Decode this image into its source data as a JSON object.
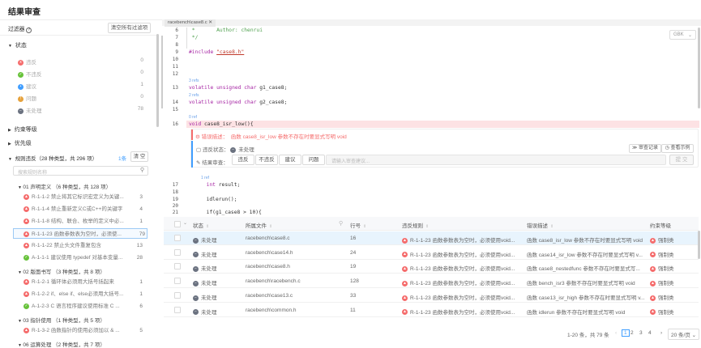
{
  "page_title": "结果审查",
  "filter": {
    "label": "过滤器",
    "clear_all": "清空所有过滤项",
    "status_section": "状态",
    "status_items": [
      {
        "label": "违反",
        "count": "0",
        "color": "red",
        "icon": "x"
      },
      {
        "label": "不违反",
        "count": "0",
        "color": "green",
        "icon": "✓"
      },
      {
        "label": "建议",
        "count": "1",
        "color": "blue",
        "icon": "•"
      },
      {
        "label": "问题",
        "count": "0",
        "color": "orange",
        "icon": "!"
      },
      {
        "label": "未处理",
        "count": "78",
        "color": "gray",
        "icon": "−"
      }
    ],
    "constraint_section": "约束等级",
    "priority_section": "优先级",
    "rules_section": "规则违反（28 种类型，共 296 项）",
    "rules_selected": "1条",
    "rules_clear": "清 空",
    "search_placeholder": "搜索规则名称",
    "groups": [
      {
        "label": "01 声明定义 （6 种类型，共 128 项）",
        "items": [
          {
            "label": "R-1-1-2 禁止将其它标识宏定义为关键...",
            "count": "3",
            "type": "red"
          },
          {
            "label": "R-1-1-4 禁止重新定义C或C++的关键字",
            "count": "4",
            "type": "red"
          },
          {
            "label": "R-1-1-8 结构、联合、枚举的定义中必...",
            "count": "1",
            "type": "red"
          },
          {
            "label": "R-1-1-23 函数参数表为空时，必须使...",
            "count": "79",
            "type": "red",
            "selected": true
          },
          {
            "label": "R-1-1-22 禁止头文件重复包含",
            "count": "13",
            "type": "red"
          },
          {
            "label": "A-1-1-1 建议使用 typedef 对基本变量...",
            "count": "28",
            "type": "green"
          }
        ]
      },
      {
        "label": "02 版面书写 （3 种类型，共 8 项）",
        "items": [
          {
            "label": "R-1-2-1 循环体必须用大括号括起来",
            "count": "1",
            "type": "red"
          },
          {
            "label": "R-1-2-2 if、else if、else必须用大括号...",
            "count": "1",
            "type": "red"
          },
          {
            "label": "A-1-2-3 C 语言程序建议使用标准 C ...",
            "count": "6",
            "type": "green"
          }
        ]
      },
      {
        "label": "03 指针使用 （1 种类型，共 5 项）",
        "items": [
          {
            "label": "R-1-3-2 函数指针的使用必须加以 & ...",
            "count": "5",
            "type": "red"
          }
        ]
      },
      {
        "label": "06 运算处理 （2 种类型，共 7 项）",
        "items": []
      }
    ]
  },
  "editor": {
    "tab": "racebench\\case8.c",
    "encoding": "GBK",
    "lines": [
      {
        "n": "6",
        "html": "<span class='cm'> *       Author: chenrui</span>"
      },
      {
        "n": "7",
        "html": "<span class='cm'> */</span>"
      },
      {
        "n": "8",
        "html": ""
      },
      {
        "n": "9",
        "html": "<span class='kw'>#include</span> <span class='str'>\"case8.h\"</span>"
      },
      {
        "n": "10",
        "html": ""
      },
      {
        "n": "11",
        "html": ""
      },
      {
        "n": "12",
        "html": ""
      },
      {
        "n": "13",
        "html": "<span class='kw'>volatile unsigned char</span> g1_case8;",
        "ref": "3 refs"
      },
      {
        "n": "14",
        "html": "<span class='kw'>volatile unsigned char</span> g2_case8;",
        "ref": "2 refs"
      },
      {
        "n": "15",
        "html": ""
      },
      {
        "n": "16",
        "html": "<span class='kw'>void</span> case8_isr_low(){",
        "ref": "0 ref"
      },
      {
        "n": "17",
        "html": "  <span class='kw'>int</span> result;",
        "ref": "1 ref"
      },
      {
        "n": "18",
        "html": ""
      },
      {
        "n": "19",
        "html": "  idlerun();"
      },
      {
        "n": "20",
        "html": ""
      },
      {
        "n": "21",
        "html": "  if(g1_case8 > 10){"
      }
    ],
    "error_label": "错误描述：",
    "error_text": "函数 case8_isr_low 参数不存在时要显式写明 void",
    "status_label": "违反状态：",
    "status_value": "未处理",
    "review_label": "结果审查：",
    "review_buttons": [
      "违反",
      "不违反",
      "建议",
      "问题"
    ],
    "review_placeholder": "请输入审查建议...",
    "history": "审查记录",
    "example": "查看示例",
    "submit": "提 交"
  },
  "table": {
    "headers": {
      "status": "状态",
      "file": "所属文件",
      "line": "行号",
      "rule": "违反规则",
      "desc": "错误描述",
      "level": "约束等级"
    },
    "rows": [
      {
        "status": "未处理",
        "file": "racebench\\case8.c",
        "line": "16",
        "rule": "R-1-1-23 函数参数表为空时，必须使用void...",
        "desc": "函数 case8_isr_low 参数不存在时要显式写明 void",
        "level": "强制类"
      },
      {
        "status": "未处理",
        "file": "racebench\\case14.h",
        "line": "24",
        "rule": "R-1-1-23 函数参数表为空时，必须使用void...",
        "desc": "函数 case14_isr_low 参数不存在时要显式写明 v...",
        "level": "强制类"
      },
      {
        "status": "未处理",
        "file": "racebench\\case8.h",
        "line": "19",
        "rule": "R-1-1-23 函数参数表为空时，必须使用void...",
        "desc": "函数 case8_nestedfunc 参数不存在时要显式写...",
        "level": "强制类"
      },
      {
        "status": "未处理",
        "file": "racebench\\racebench.c",
        "line": "128",
        "rule": "R-1-1-23 函数参数表为空时，必须使用void...",
        "desc": "函数 bench_isr3 参数不存在时要显式写明 void",
        "level": "强制类"
      },
      {
        "status": "未处理",
        "file": "racebench\\case13.c",
        "line": "33",
        "rule": "R-1-1-23 函数参数表为空时，必须使用void...",
        "desc": "函数 case13_isr_high 参数不存在时要显式写明 v...",
        "level": "强制类"
      },
      {
        "status": "未处理",
        "file": "racebench\\common.h",
        "line": "11",
        "rule": "R-1-1-23 函数参数表为空时，必须使用void...",
        "desc": "函数 idlerun 参数不存在时要显式写明 void",
        "level": "强制类"
      }
    ],
    "pagination": {
      "summary": "1-20 条，共 79 条",
      "pages": [
        "1",
        "2",
        "3",
        "4"
      ],
      "current": "1",
      "page_size": "20 条/页"
    }
  }
}
